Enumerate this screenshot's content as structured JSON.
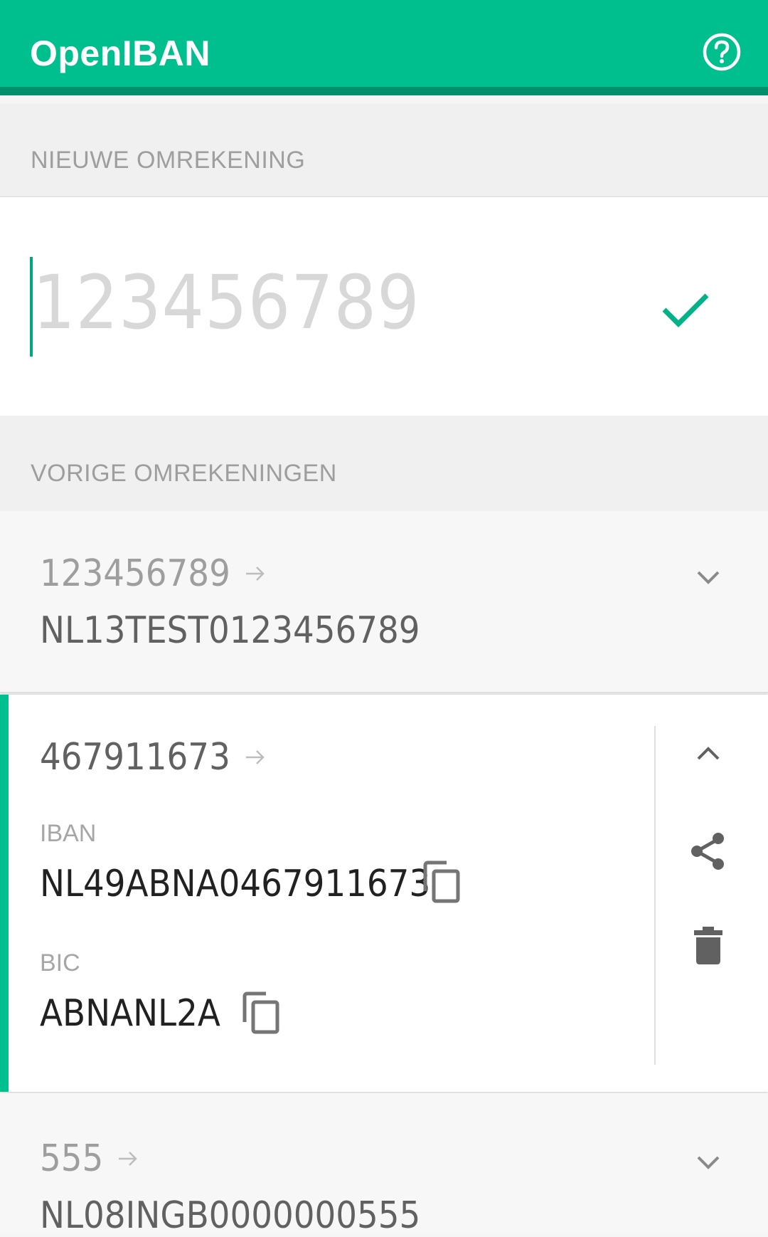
{
  "appbar": {
    "title": "OpenIBAN",
    "help_icon": "help-circle-icon",
    "color": "#00bf8f",
    "shadow_color": "#008f6a"
  },
  "new_conversion": {
    "header": "NIEUWE OMREKENING",
    "input_placeholder": "123456789",
    "submit_icon": "check-icon",
    "accent": "#00a882"
  },
  "previous_conversions": {
    "header": "VORIGE OMREKENINGEN",
    "items": [
      {
        "number": "123456789",
        "iban": "NL13TEST0123456789",
        "expanded": false
      },
      {
        "number": "467911673",
        "expanded": true,
        "iban_label": "IBAN",
        "iban": "NL49ABNA0467911673",
        "bic_label": "BIC",
        "bic": "ABNANL2A"
      },
      {
        "number": "555",
        "iban": "NL08INGB0000000555",
        "expanded": false
      }
    ]
  }
}
